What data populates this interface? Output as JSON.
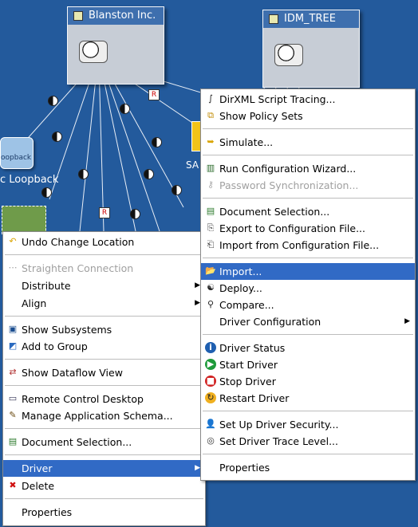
{
  "canvas": {
    "nodes": {
      "blanston": {
        "title": "Blanston Inc."
      },
      "idm_tree": {
        "title": "IDM_TREE"
      },
      "loopback": {
        "text": "oopback"
      }
    },
    "labels": {
      "loopback_label": "c Loopback",
      "sap_label": "SA"
    }
  },
  "driver_menu": {
    "items": [
      {
        "label": "DirXML Script Tracing...",
        "icon": "script-icon"
      },
      {
        "label": "Show Policy Sets",
        "icon": "policy-icon"
      },
      {
        "label": "Simulate...",
        "icon": "simulate-icon"
      },
      {
        "label": "Run Configuration Wizard...",
        "icon": "wizard-icon"
      },
      {
        "label": "Password Synchronization...",
        "icon": "password-icon",
        "disabled": true
      },
      {
        "label": "Document Selection...",
        "icon": "document-icon"
      },
      {
        "label": "Export to Configuration File...",
        "icon": "export-icon"
      },
      {
        "label": "Import from Configuration File...",
        "icon": "import-file-icon"
      },
      {
        "label": "Import...",
        "icon": "folder-open-icon",
        "selected": true
      },
      {
        "label": "Deploy...",
        "icon": "deploy-icon"
      },
      {
        "label": "Compare...",
        "icon": "compare-icon"
      },
      {
        "label": "Driver Configuration",
        "icon": "",
        "submenu": true
      },
      {
        "label": "Driver Status",
        "icon": "info-icon"
      },
      {
        "label": "Start Driver",
        "icon": "start-icon"
      },
      {
        "label": "Stop Driver",
        "icon": "stop-icon"
      },
      {
        "label": "Restart Driver",
        "icon": "restart-icon"
      },
      {
        "label": "Set Up Driver Security...",
        "icon": "security-icon"
      },
      {
        "label": "Set Driver Trace Level...",
        "icon": "trace-icon"
      },
      {
        "label": "Properties",
        "icon": ""
      }
    ]
  },
  "main_menu": {
    "items": [
      {
        "label": "Undo Change Location",
        "icon": "undo-icon"
      },
      {
        "label": "Straighten Connection",
        "icon": "straighten-icon",
        "disabled": true
      },
      {
        "label": "Distribute",
        "icon": "",
        "submenu": true
      },
      {
        "label": "Align",
        "icon": "",
        "submenu": true
      },
      {
        "label": "Show Subsystems",
        "icon": "subsystems-icon"
      },
      {
        "label": "Add to Group",
        "icon": "group-icon"
      },
      {
        "label": "Show Dataflow View",
        "icon": "dataflow-icon"
      },
      {
        "label": "Remote Control Desktop",
        "icon": "desktop-icon"
      },
      {
        "label": "Manage Application Schema...",
        "icon": "schema-icon"
      },
      {
        "label": "Document Selection...",
        "icon": "document-icon"
      },
      {
        "label": "Driver",
        "icon": "",
        "submenu": true,
        "selected": true
      },
      {
        "label": "Delete",
        "icon": "delete-icon"
      },
      {
        "label": "Properties",
        "icon": ""
      }
    ]
  },
  "colors": {
    "canvas_bg": "#235a9c",
    "selection": "#316ac5"
  }
}
